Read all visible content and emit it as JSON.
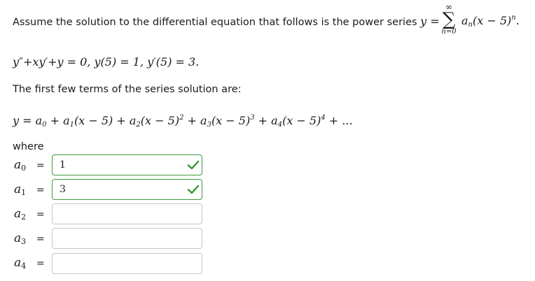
{
  "intro": {
    "text": "Assume the solution to the differential equation that follows is the power series",
    "series_lhs": "y =",
    "sum_symbol": "∑",
    "sum_upper": "∞",
    "sum_lower": "n=0",
    "series_coef": "a",
    "series_coef_sub": "n",
    "series_base": "(x − 5)",
    "series_exp": "n",
    "period": "."
  },
  "equation": "y″+xy′+y = 0,  y(5) = 1,  y′(5) = 3.",
  "first_terms_text": "The first few terms of the series solution are:",
  "series_terms": {
    "t0": "y = a",
    "s0": "0",
    "t1": " + a",
    "s1": "1",
    "t1b": "(x − 5) + a",
    "s2": "2",
    "t2b": "(x − 5)",
    "e2": "2",
    "t3": " + a",
    "s3": "3",
    "t3b": "(x − 5)",
    "e3": "3",
    "t4": " + a",
    "s4": "4",
    "t4b": "(x − 5)",
    "e4": "4",
    "tail": " + ..."
  },
  "where_text": "where",
  "coefficients": [
    {
      "label": "a",
      "sub": "0",
      "eq": "=",
      "value": "1",
      "status": "correct"
    },
    {
      "label": "a",
      "sub": "1",
      "eq": "=",
      "value": "3",
      "status": "correct"
    },
    {
      "label": "a",
      "sub": "2",
      "eq": "=",
      "value": "",
      "status": "empty"
    },
    {
      "label": "a",
      "sub": "3",
      "eq": "=",
      "value": "",
      "status": "empty"
    },
    {
      "label": "a",
      "sub": "4",
      "eq": "=",
      "value": "",
      "status": "empty"
    }
  ],
  "icons": {
    "correct": "checkmark-icon"
  },
  "colors": {
    "correct_border": "#3c9a3c",
    "check": "#2e9a2e",
    "empty_border": "#c7c7c7"
  }
}
